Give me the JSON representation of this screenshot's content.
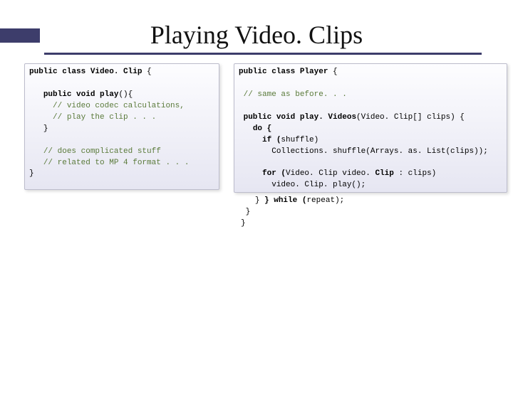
{
  "title": "Playing Video. Clips",
  "left": {
    "decl": {
      "pre": "public class ",
      "name": "Video. Clip",
      "post": " {"
    },
    "method": {
      "pre": "public void ",
      "name": "play",
      "post": "(){"
    },
    "c1": "// video codec calculations,",
    "c2": "// play the clip . . .",
    "closeMethod": "}",
    "c3": "// does complicated stuff",
    "c4": "// related to MP 4 format . . .",
    "closeClass": "}"
  },
  "right": {
    "decl": {
      "pre": "public class ",
      "name": "Player",
      "post": " {"
    },
    "c1": "// same as before. . .",
    "method": {
      "pre": "public void ",
      "name": "play. Videos",
      "post": "(Video. Clip[] clips) {"
    },
    "do": "do {",
    "ifpre": "if (",
    "ifvar": "shuffle",
    "ifpost": ")",
    "shuffle": "Collections. shuffle(Arrays. as. List(clips));",
    "forpre": "for (",
    "fortype": "Video. Clip video. ",
    "forvar": "Clip",
    "forpost": " : clips)",
    "play": "video. Clip. play();"
  },
  "trail": {
    "whilepre": "} while (",
    "whilevar": "repeat",
    "whilepost": ");",
    "close1": "}",
    "close2": "}"
  }
}
